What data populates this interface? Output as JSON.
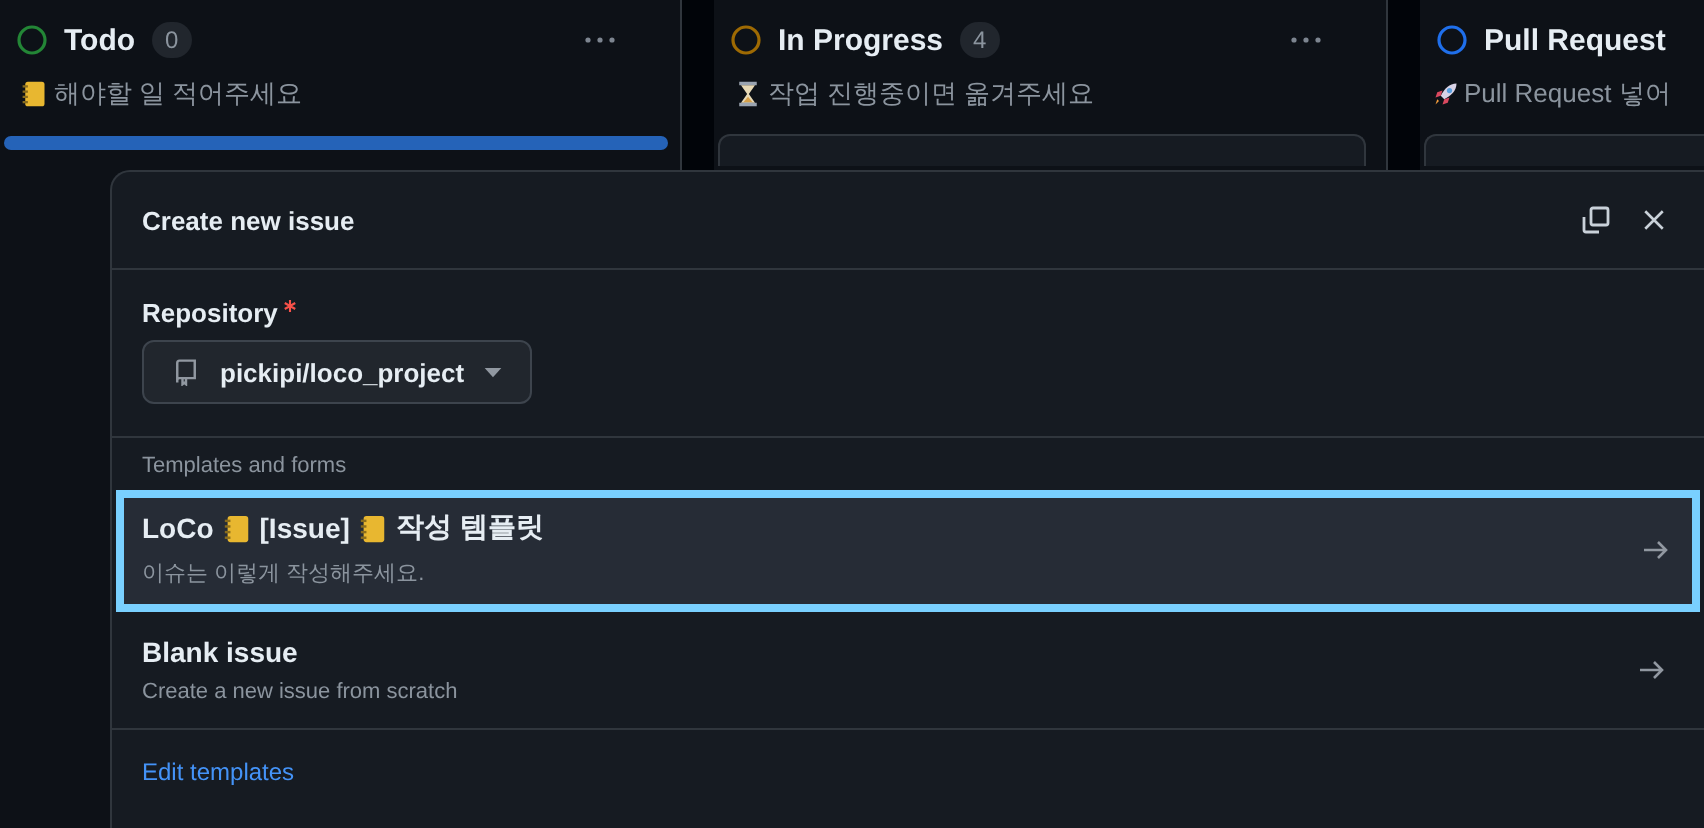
{
  "board": {
    "columns": [
      {
        "title": "Todo",
        "count": "0",
        "color": "#238636",
        "kind": "notebook",
        "description": "해야할 일 적어주세요",
        "drop_indicator": true,
        "card": false
      },
      {
        "title": "In Progress",
        "count": "4",
        "color": "#9e6a03",
        "kind": "hourglass",
        "description": "작업 진행중이면 옮겨주세요",
        "drop_indicator": false,
        "card": true
      },
      {
        "title": "Pull Request",
        "color": "#1f6feb",
        "kind": "rocket",
        "description": "Pull Request 넣어",
        "drop_indicator": false,
        "card": true
      }
    ]
  },
  "dialog": {
    "title": "Create new issue",
    "repository": {
      "label": "Repository",
      "required": true,
      "value": "pickipi/loco_project"
    },
    "templates_heading": "Templates and forms",
    "templates": [
      {
        "title": [
          {
            "kind": "text",
            "text": "LoCo"
          },
          {
            "kind": "notebook"
          },
          {
            "kind": "text",
            "text": "[Issue]"
          },
          {
            "kind": "notebook"
          },
          {
            "kind": "text",
            "text": "작성 템플릿"
          }
        ],
        "description": "이슈는 이렇게 작성해주세요.",
        "selected": true
      },
      {
        "title": [
          {
            "kind": "text",
            "text": "Blank issue"
          }
        ],
        "description": "Create a new issue from scratch",
        "selected": false
      }
    ],
    "footer_link": "Edit templates"
  }
}
